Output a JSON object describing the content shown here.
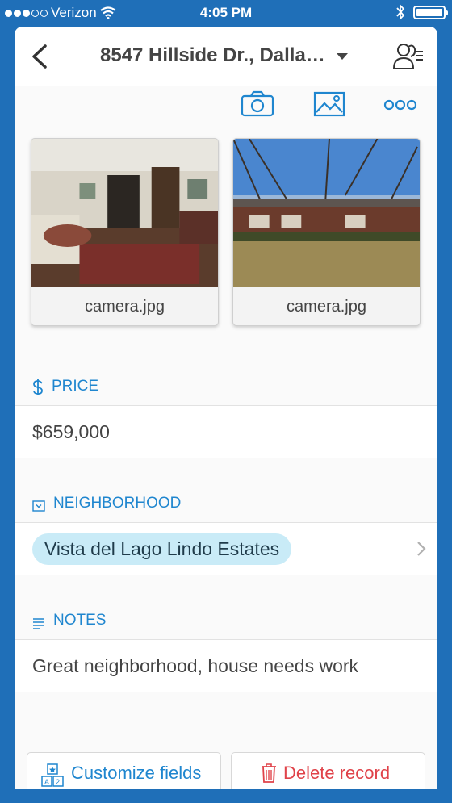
{
  "status_bar": {
    "carrier": "Verizon",
    "time": "4:05 PM"
  },
  "header": {
    "title": "8547 Hillside Dr., Dalla…"
  },
  "toolbar": {
    "icons": [
      "camera-icon",
      "image-icon",
      "more-icon"
    ]
  },
  "attachments": [
    {
      "caption": "camera.jpg"
    },
    {
      "caption": "camera.jpg"
    }
  ],
  "fields": {
    "price": {
      "label": "PRICE",
      "value": "$659,000"
    },
    "neighborhood": {
      "label": "NEIGHBORHOOD",
      "value": "Vista del Lago Lindo Estates"
    },
    "notes": {
      "label": "NOTES",
      "value": "Great neighborhood, house needs work"
    }
  },
  "footer": {
    "customize_label": "Customize fields",
    "delete_label": "Delete record"
  },
  "colors": {
    "accent": "#1f86cf",
    "background": "#1f6fb8",
    "danger": "#e0434a",
    "pill": "#c9ebf7"
  }
}
